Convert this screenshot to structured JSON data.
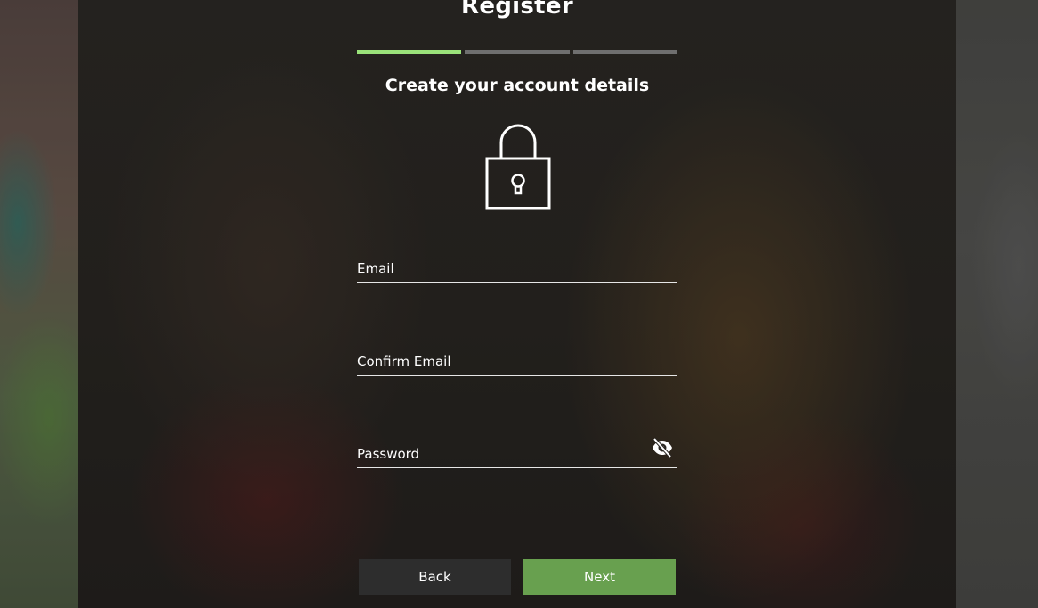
{
  "page": {
    "title": "Register",
    "subtitle": "Create your account details"
  },
  "progress": {
    "total_steps": 3,
    "current_step": 1,
    "active_color": "#9ae27a",
    "inactive_color": "#6f6f6f"
  },
  "form": {
    "email_label": "Email",
    "email_value": "",
    "confirm_email_label": "Confirm Email",
    "confirm_email_value": "",
    "password_label": "Password",
    "password_value": "",
    "password_toggle_icon": "eye-off-icon"
  },
  "buttons": {
    "back_label": "Back",
    "next_label": "Next",
    "next_color": "#68a04f"
  },
  "icons": {
    "lock": "lock-icon"
  }
}
